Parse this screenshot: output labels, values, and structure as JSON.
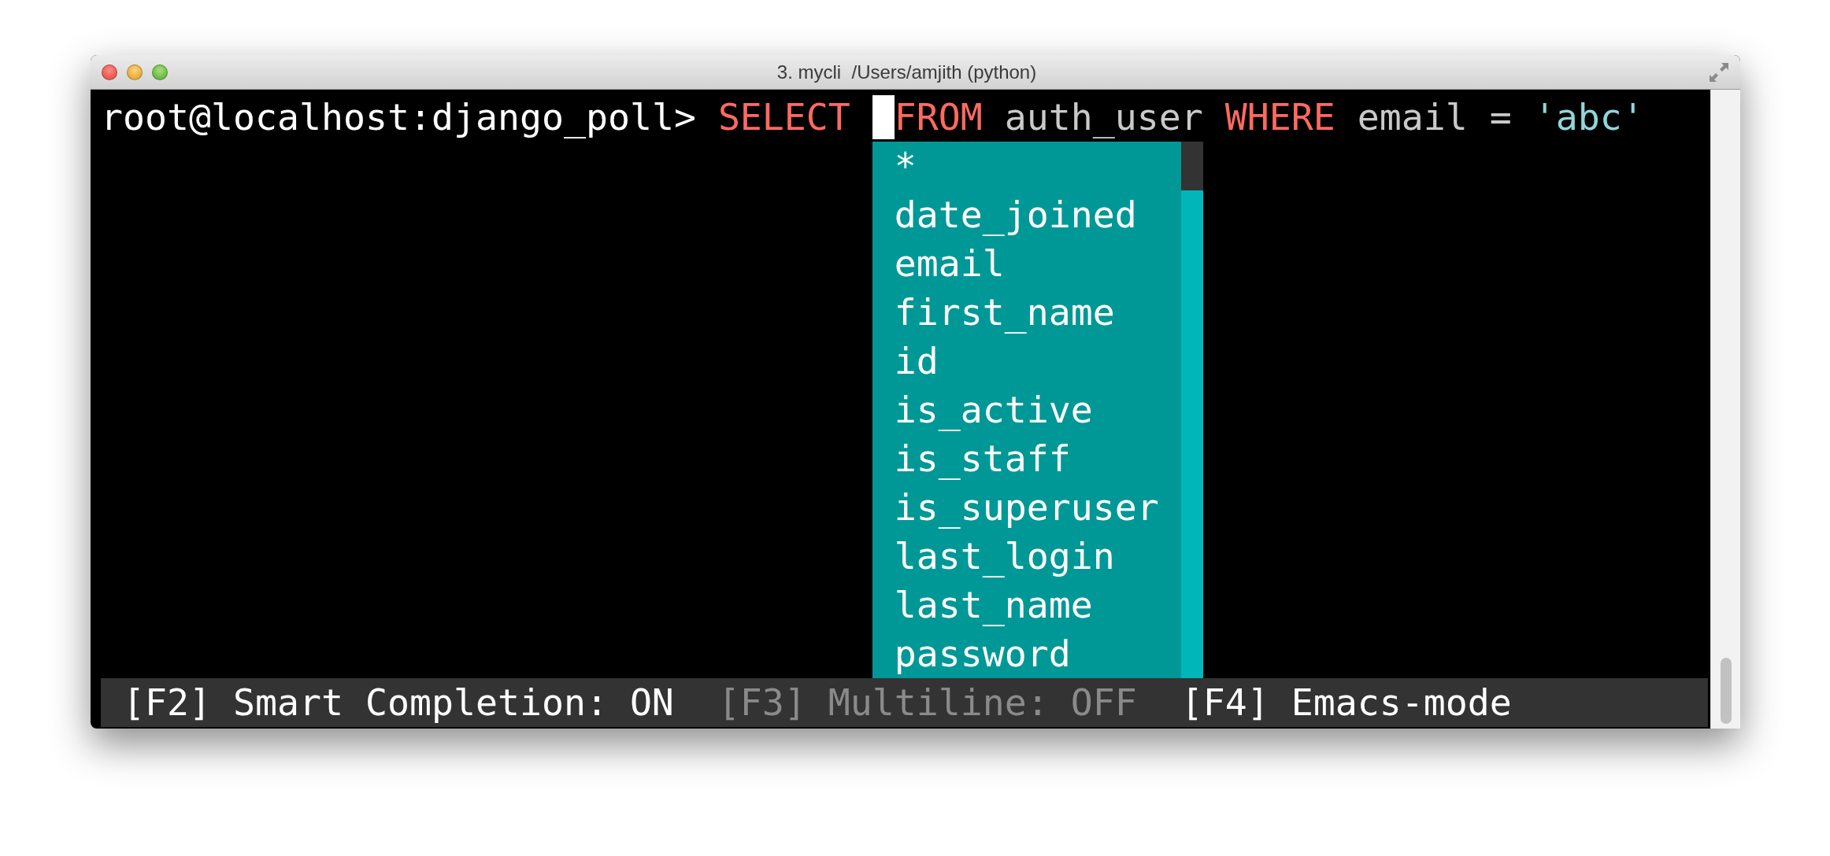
{
  "window": {
    "title": "3. mycli  /Users/amjith (python)"
  },
  "prompt_line": [
    {
      "kind": "prompt",
      "text": "root@localhost:django_poll> "
    },
    {
      "kind": "keyword",
      "text": "SELECT"
    },
    {
      "kind": "cursor"
    },
    {
      "kind": "keyword",
      "text": "FROM"
    },
    {
      "kind": "plain",
      "text": " auth_user "
    },
    {
      "kind": "keyword",
      "text": "WHERE"
    },
    {
      "kind": "plain",
      "text": " email = "
    },
    {
      "kind": "string",
      "text": "'abc'"
    }
  ],
  "completions": [
    {
      "label": "*",
      "selected": false
    },
    {
      "label": "date_joined",
      "selected": false
    },
    {
      "label": "email",
      "selected": false
    },
    {
      "label": "first_name",
      "selected": false
    },
    {
      "label": "id",
      "selected": false
    },
    {
      "label": "is_active",
      "selected": false
    },
    {
      "label": "is_staff",
      "selected": false
    },
    {
      "label": "is_superuser",
      "selected": false
    },
    {
      "label": "last_login",
      "selected": false
    },
    {
      "label": "last_name",
      "selected": false
    },
    {
      "label": "password",
      "selected": false
    }
  ],
  "status_bar": [
    {
      "text": "[F2] Smart Completion: ON",
      "active": true
    },
    {
      "text": "[F3] Multiline: OFF",
      "active": false
    },
    {
      "text": "[F4] Emacs-mode",
      "active": true
    }
  ]
}
